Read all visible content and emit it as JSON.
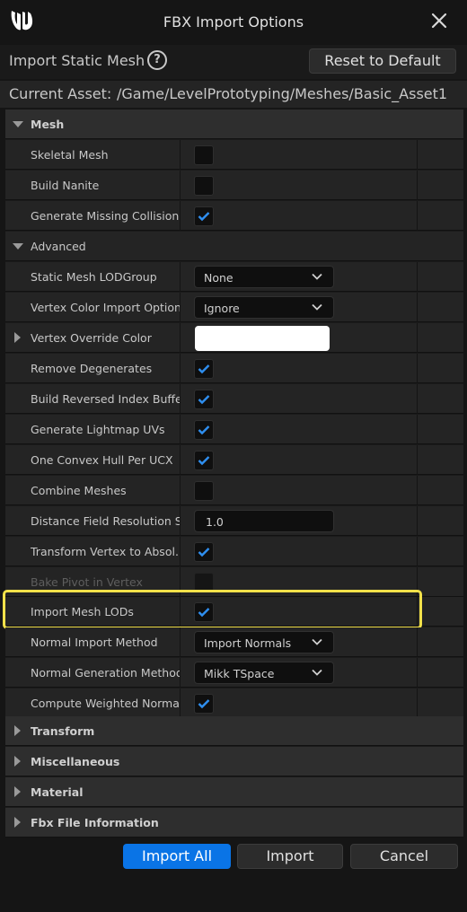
{
  "window": {
    "title": "FBX Import Options"
  },
  "header": {
    "title": "Import Static Mesh",
    "reset_label": "Reset to Default"
  },
  "asset": {
    "label": "Current Asset:",
    "path": "/Game/LevelPrototyping/Meshes/Basic_Asset1"
  },
  "sections": {
    "mesh": "Mesh",
    "advanced": "Advanced",
    "transform": "Transform",
    "misc": "Miscellaneous",
    "material": "Material",
    "fbx_info": "Fbx File Information"
  },
  "props": {
    "skeletal_mesh": {
      "label": "Skeletal Mesh",
      "checked": false
    },
    "build_nanite": {
      "label": "Build Nanite",
      "checked": false
    },
    "gen_missing_collision": {
      "label": "Generate Missing Collision",
      "checked": true
    },
    "lod_group": {
      "label": "Static Mesh LODGroup",
      "value": "None"
    },
    "vertex_color_import": {
      "label": "Vertex Color Import Option",
      "value": "Ignore"
    },
    "vertex_override_color": {
      "label": "Vertex Override Color",
      "color": "#ffffff"
    },
    "remove_degenerates": {
      "label": "Remove Degenerates",
      "checked": true
    },
    "build_reversed_index": {
      "label": "Build Reversed Index Buffer",
      "checked": true
    },
    "gen_lightmap_uvs": {
      "label": "Generate Lightmap UVs",
      "checked": true
    },
    "one_convex_hull": {
      "label": "One Convex Hull Per UCX",
      "checked": true
    },
    "combine_meshes": {
      "label": "Combine Meshes",
      "checked": false
    },
    "distance_field_res": {
      "label": "Distance Field Resolution S...",
      "value": "1.0"
    },
    "transform_vertex": {
      "label": "Transform Vertex to Absol...",
      "checked": true
    },
    "bake_pivot": {
      "label": "Bake Pivot in Vertex",
      "checked": false
    },
    "import_mesh_lods": {
      "label": "Import Mesh LODs",
      "checked": true
    },
    "normal_import_method": {
      "label": "Normal Import Method",
      "value": "Import Normals"
    },
    "normal_gen_method": {
      "label": "Normal Generation Method",
      "value": "Mikk TSpace"
    },
    "compute_weighted_normals": {
      "label": "Compute Weighted Normals",
      "checked": true
    }
  },
  "footer": {
    "import_all": "Import All",
    "import": "Import",
    "cancel": "Cancel"
  },
  "colors": {
    "accent": "#0a74e6",
    "highlight": "#f2e14a",
    "check": "#2f8ff0"
  }
}
